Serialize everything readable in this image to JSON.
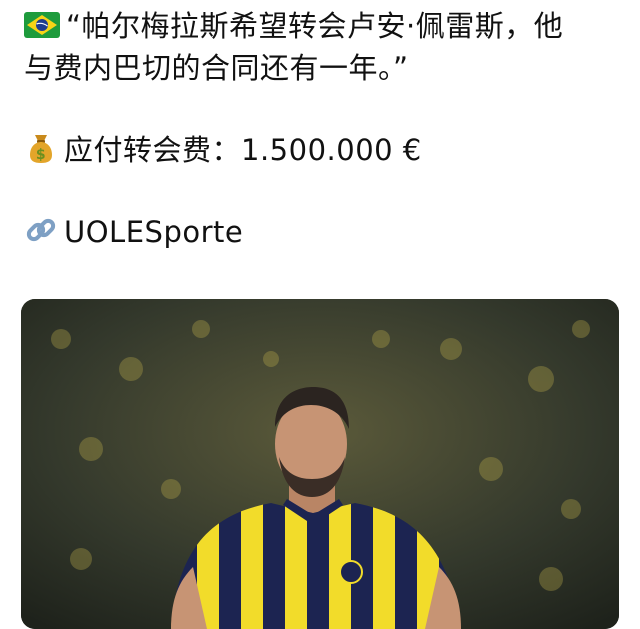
{
  "post": {
    "quote_line_1": "“帕尔梅拉斯希望转会卢安·佩雷斯，他",
    "quote_line_2": "与费内巴切的合同还有一年。”",
    "fee_line": "应付转会费：1.500.000 €",
    "source_line": "UOLESporte",
    "icons": {
      "flag": "brazil-flag-icon",
      "fee": "money-bag-icon",
      "source": "link-icon"
    },
    "colors": {
      "text": "#111111",
      "jersey_yellow": "#f2dc2a",
      "jersey_navy": "#1c2451",
      "background": "#ffffff"
    }
  }
}
